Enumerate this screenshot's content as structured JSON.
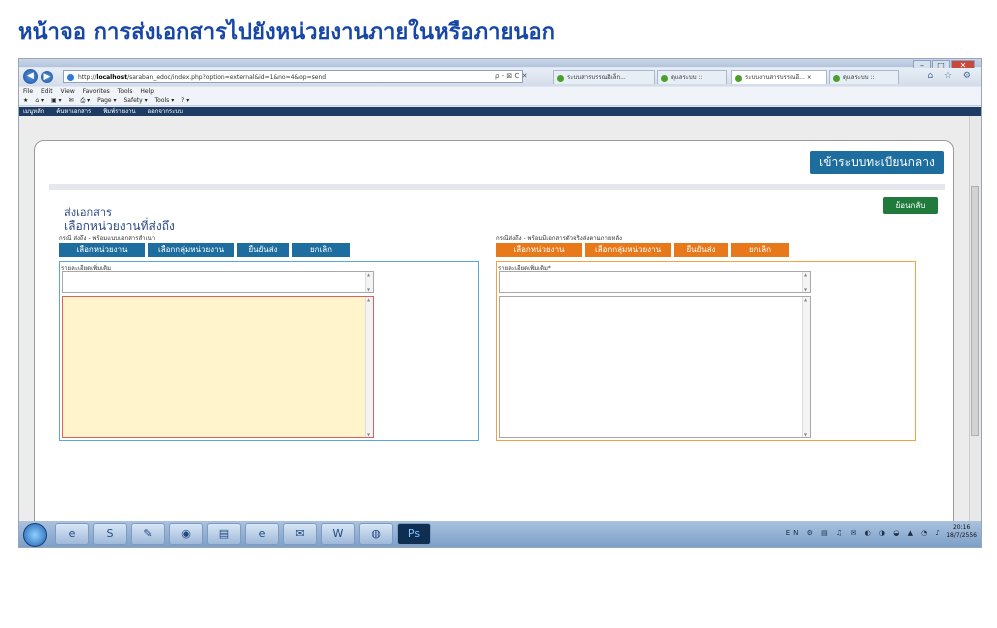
{
  "heading": "หน้าจอ การส่งเอกสารไปยังหน่วยงานภายในหรือภายนอก",
  "browser": {
    "url_prefix": "http://",
    "url_host": "localhost",
    "url_path": "/saraban_edoc/index.php?option=external&id=1&no=4&op=send",
    "address_tools": "ρ - ⊠ C ✕",
    "tabs": [
      "ระบบสารบรรณอิเล็ก...",
      "ดุแลระบบ ::",
      "ระบบงานสารบรรณอี... ×",
      "ดุแลระบบ ::"
    ],
    "menu": [
      "File",
      "Edit",
      "View",
      "Favorites",
      "Tools",
      "Help"
    ],
    "command_bar": [
      "Page ▾",
      "Safety ▾",
      "Tools ▾"
    ],
    "window_controls": [
      "–",
      "□",
      "✕"
    ],
    "right_tools": "⌂ ☆ ⚙"
  },
  "site_nav": [
    "เมนูหลัก",
    "ค้นหาเอกสาร",
    "พิมพ์รายงาน",
    "ออกจากระบบ"
  ],
  "register_button": "เข้าระบบทะเบียนกลาง",
  "section_title": "ส่งเอกสาร",
  "subtitle": "เลือกหน่วยงานที่ส่งถึง",
  "back_button": "ย้อนกลับ",
  "left": {
    "caption": "กรณี ส่งถึง - พร้อมแนบเอกสารสำเนา",
    "buttons": [
      "เลือกหน่วยงาน",
      "เลือกกลุ่มหน่วยงาน",
      "ยืนยันส่ง",
      "ยกเลิก"
    ],
    "detail_label": "รายละเอียดเพิ่มเติม"
  },
  "right": {
    "caption": "กรณีส่งถึง - พร้อมมีเอกสารตัวจริงส่งตามภายหลัง",
    "buttons": [
      "เลือกหน่วยงาน",
      "เลือกกลุ่มหน่วยงาน",
      "ยืนยันส่ง",
      "ยกเลิก"
    ],
    "detail_label": "รายละเอียดเพิ่มเติม*"
  },
  "taskbar": {
    "icons": [
      "ie",
      "explorer",
      "skype",
      "paint",
      "chrome",
      "folder",
      "ie2",
      "notepad",
      "word",
      "firefox",
      "photoshop"
    ],
    "photoshop_label": "Ps",
    "lang": "EN",
    "time": "20:16",
    "date": "18/7/2556"
  },
  "colors": {
    "primary": "#1d6e9e",
    "accent": "#e8791b",
    "heading": "#1747a6",
    "back": "#1f7a3c"
  }
}
